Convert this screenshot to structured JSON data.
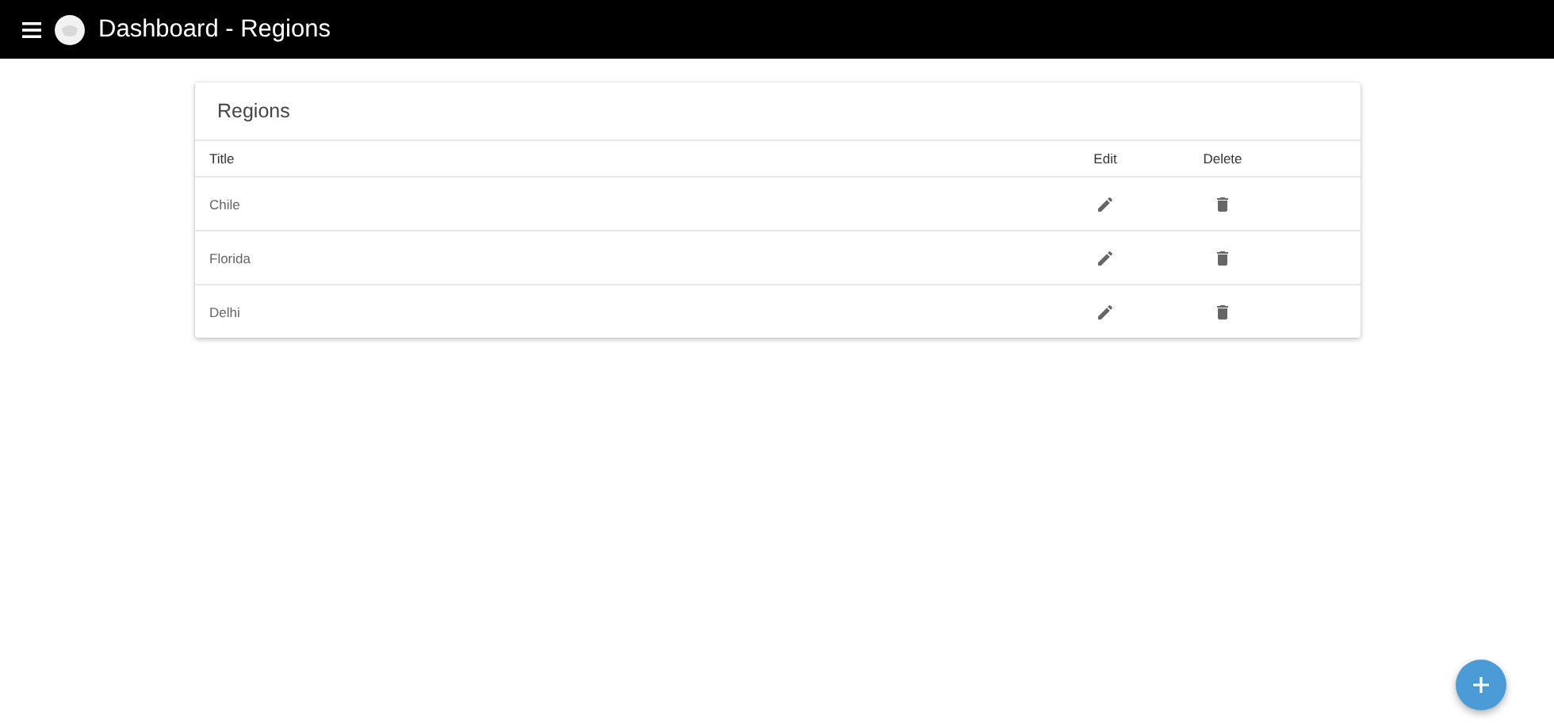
{
  "app_bar": {
    "title": "Dashboard - Regions"
  },
  "card": {
    "title": "Regions",
    "columns": [
      "Title",
      "Edit",
      "Delete"
    ],
    "rows": [
      {
        "title": "Chile"
      },
      {
        "title": "Florida"
      },
      {
        "title": "Delhi"
      }
    ]
  }
}
